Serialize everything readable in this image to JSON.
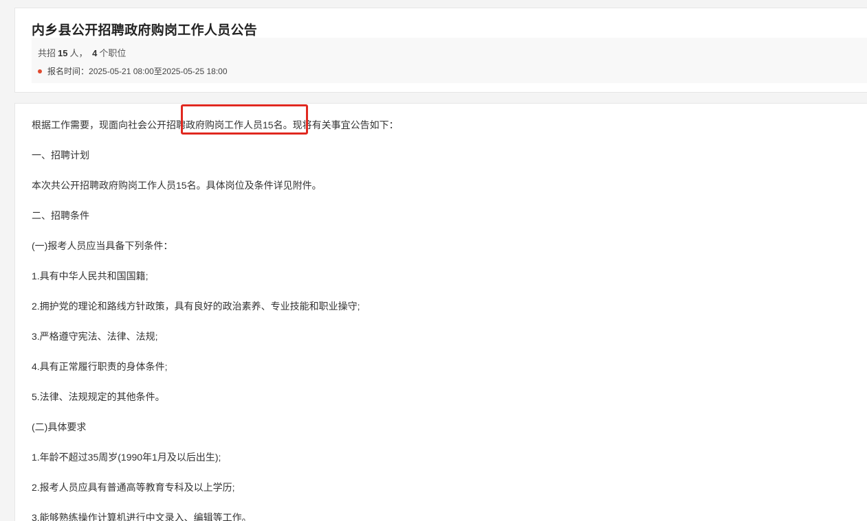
{
  "header": {
    "title": "内乡县公开招聘政府购岗工作人员公告",
    "count_prefix": "共招",
    "total_people": "15",
    "people_unit": "人，",
    "positions": "4",
    "positions_unit": "个职位",
    "registration_label": "报名时间：",
    "registration_period": "2025-05-21 08:00至2025-05-25 18:00"
  },
  "article": {
    "paragraphs": [
      "根据工作需要，现面向社会公开招聘政府购岗工作人员15名。现将有关事宜公告如下：",
      "一、招聘计划",
      "本次共公开招聘政府购岗工作人员15名。具体岗位及条件详见附件。",
      "二、招聘条件",
      "(一)报考人员应当具备下列条件：",
      "1.具有中华人民共和国国籍;",
      "2.拥护党的理论和路线方针政策，具有良好的政治素养、专业技能和职业操守;",
      "3.严格遵守宪法、法律、法规;",
      "4.具有正常履行职责的身体条件;",
      "5.法律、法规规定的其他条件。",
      "(二)具体要求",
      "1.年龄不超过35周岁(1990年1月及以后出生);",
      "2.报考人员应具有普通高等教育专科及以上学历;",
      "3.能够熟练操作计算机进行中文录入、编辑等工作。"
    ]
  },
  "colors": {
    "highlight_border": "#e0281f",
    "status_dot": "#e04a2f"
  }
}
